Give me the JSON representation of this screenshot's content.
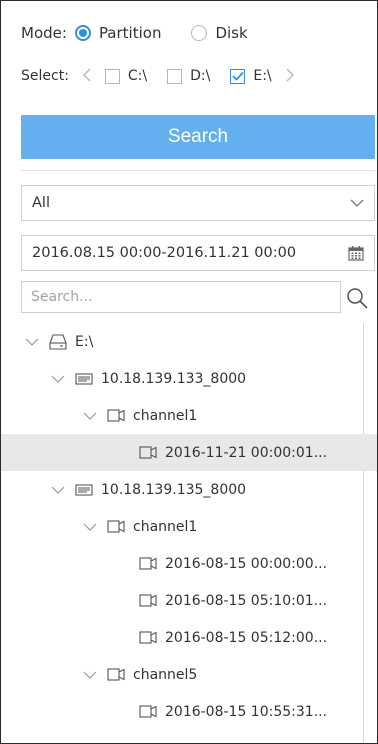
{
  "mode": {
    "label": "Mode:",
    "options": [
      {
        "label": "Partition",
        "selected": true
      },
      {
        "label": "Disk",
        "selected": false
      }
    ]
  },
  "select": {
    "label": "Select:",
    "drives": [
      {
        "label": "C:\\",
        "checked": false
      },
      {
        "label": "D:\\",
        "checked": false
      },
      {
        "label": "E:\\",
        "checked": true
      }
    ]
  },
  "search_button": "Search",
  "filter": {
    "value": "All"
  },
  "date_range": {
    "value": "2016.08.15 00:00-2016.11.21 00:00"
  },
  "search": {
    "placeholder": "Search..."
  },
  "tree": [
    {
      "label": "E:\\",
      "type": "drive",
      "level": 0,
      "expandable": true,
      "selected": false
    },
    {
      "label": "10.18.139.133_8000",
      "type": "device",
      "level": 1,
      "expandable": true,
      "selected": false
    },
    {
      "label": "channel1",
      "type": "channel",
      "level": 2,
      "expandable": true,
      "selected": false
    },
    {
      "label": "2016-11-21  00:00:01...",
      "type": "record",
      "level": 3,
      "expandable": false,
      "selected": true
    },
    {
      "label": "10.18.139.135_8000",
      "type": "device",
      "level": 1,
      "expandable": true,
      "selected": false
    },
    {
      "label": "channel1",
      "type": "channel",
      "level": 2,
      "expandable": true,
      "selected": false
    },
    {
      "label": "2016-08-15  00:00:00...",
      "type": "record",
      "level": 3,
      "expandable": false,
      "selected": false
    },
    {
      "label": "2016-08-15  05:10:01...",
      "type": "record",
      "level": 3,
      "expandable": false,
      "selected": false
    },
    {
      "label": "2016-08-15  05:12:00...",
      "type": "record",
      "level": 3,
      "expandable": false,
      "selected": false
    },
    {
      "label": "channel5",
      "type": "channel",
      "level": 2,
      "expandable": true,
      "selected": false
    },
    {
      "label": "2016-08-15  10:55:31...",
      "type": "record",
      "level": 3,
      "expandable": false,
      "selected": false
    }
  ],
  "colors": {
    "accent": "#2f8fe0",
    "button": "#64b0ee",
    "selected_row": "#e8e8e8"
  }
}
